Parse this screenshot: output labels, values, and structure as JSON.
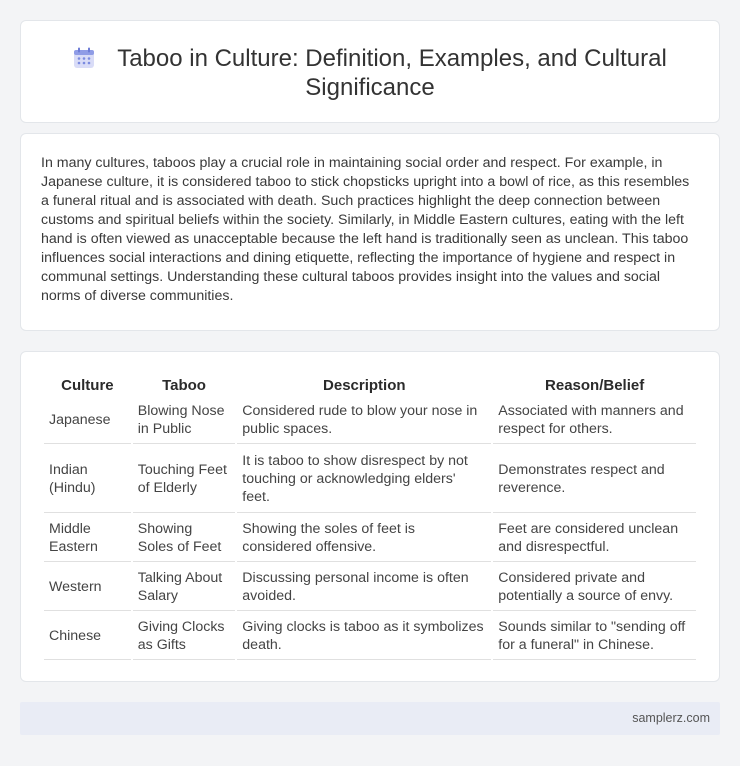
{
  "header": {
    "title_line1": "Taboo in Culture: Definition, Examples, and Cultural",
    "title_line2": "Significance",
    "icon": "calendar-icon"
  },
  "intro": {
    "text": "In many cultures, taboos play a crucial role in maintaining social order and respect. For example, in Japanese culture, it is considered taboo to stick chopsticks upright into a bowl of rice, as this resembles a funeral ritual and is associated with death. Such practices highlight the deep connection between customs and spiritual beliefs within the society. Similarly, in Middle Eastern cultures, eating with the left hand is often viewed as unacceptable because the left hand is traditionally seen as unclean. This taboo influences social interactions and dining etiquette, reflecting the importance of hygiene and respect in communal settings. Understanding these cultural taboos provides insight into the values and social norms of diverse communities."
  },
  "table": {
    "headers": [
      "Culture",
      "Taboo",
      "Description",
      "Reason/Belief"
    ],
    "rows": [
      [
        "Japanese",
        "Blowing Nose in Public",
        "Considered rude to blow your nose in public spaces.",
        "Associated with manners and respect for others."
      ],
      [
        "Indian (Hindu)",
        "Touching Feet of Elderly",
        "It is taboo to show disrespect by not touching or acknowledging elders' feet.",
        "Demonstrates respect and reverence."
      ],
      [
        "Middle Eastern",
        "Showing Soles of Feet",
        "Showing the soles of feet is considered offensive.",
        "Feet are considered unclean and disrespectful."
      ],
      [
        "Western",
        "Talking About Salary",
        "Discussing personal income is often avoided.",
        "Considered private and potentially a source of envy."
      ],
      [
        "Chinese",
        "Giving Clocks as Gifts",
        "Giving clocks is taboo as it symbolizes death.",
        "Sounds similar to \"sending off for a funeral\" in Chinese."
      ]
    ]
  },
  "footer": {
    "site": "samplerz.com"
  },
  "colors": {
    "accent": "#7b8be0",
    "footer_bg": "#e9ecf5"
  }
}
